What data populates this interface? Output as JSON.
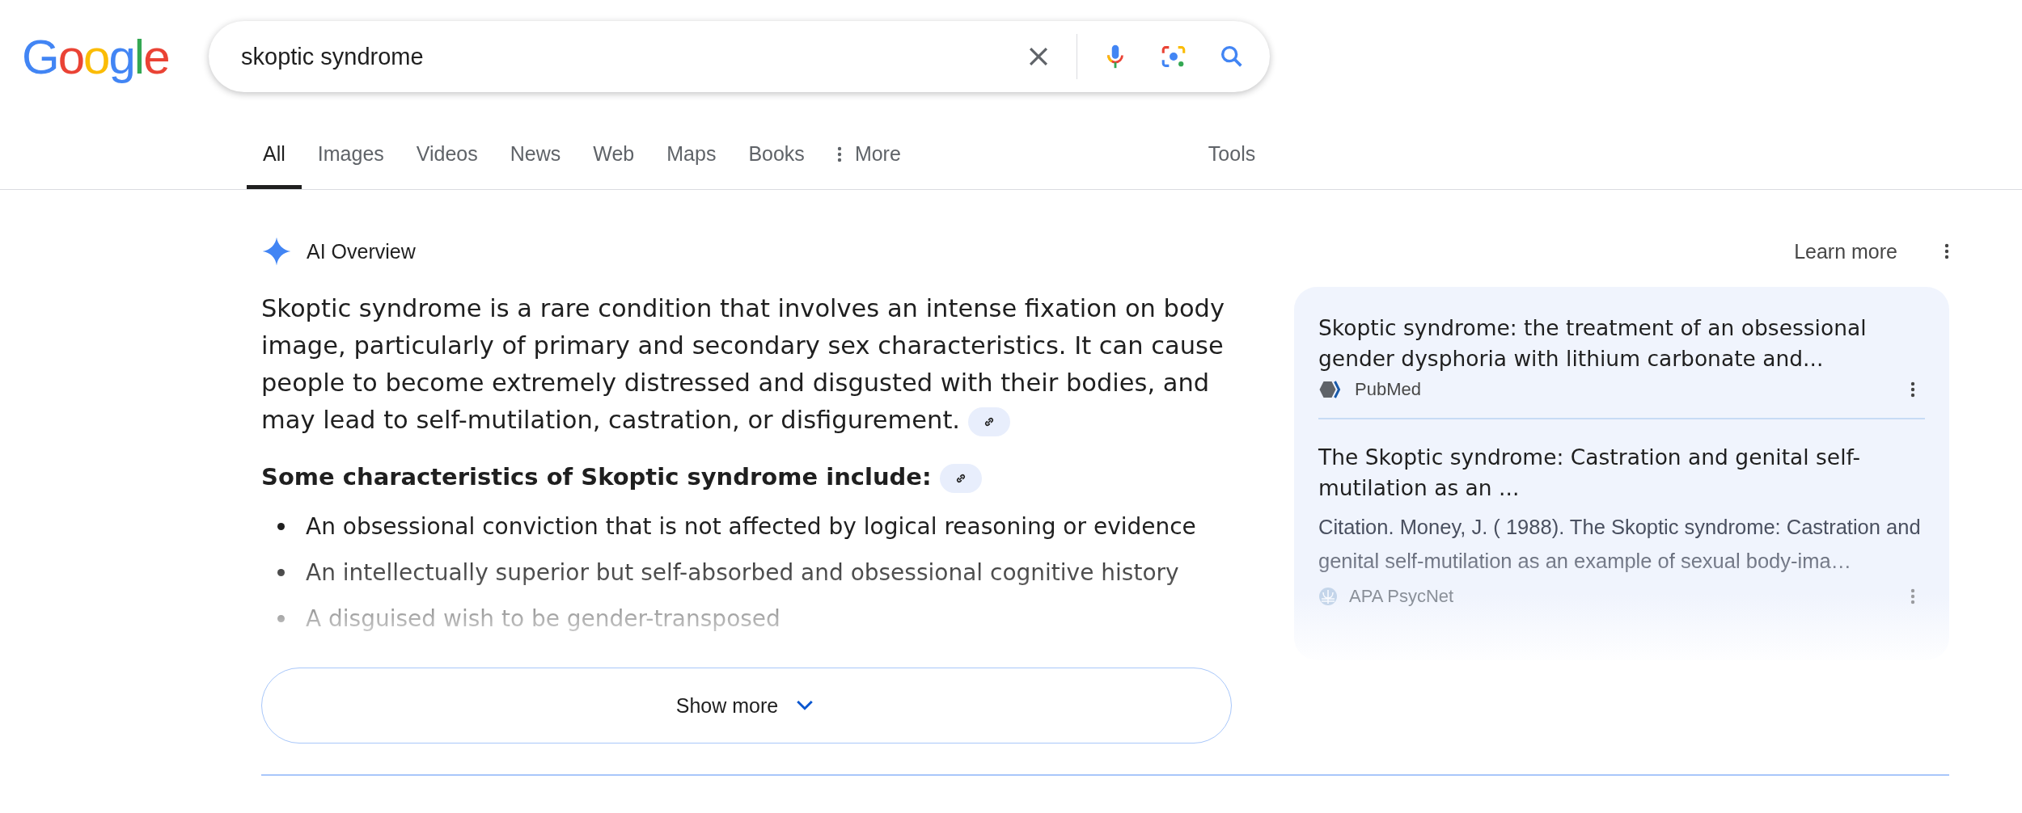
{
  "logo": "Google",
  "search": {
    "value": "skoptic syndrome"
  },
  "tabs": [
    {
      "label": "All",
      "selected": true,
      "kind": "plain"
    },
    {
      "label": "Images",
      "selected": false,
      "kind": "plain"
    },
    {
      "label": "Videos",
      "selected": false,
      "kind": "plain"
    },
    {
      "label": "News",
      "selected": false,
      "kind": "plain"
    },
    {
      "label": "Web",
      "selected": false,
      "kind": "plain"
    },
    {
      "label": "Maps",
      "selected": false,
      "kind": "plain"
    },
    {
      "label": "Books",
      "selected": false,
      "kind": "plain"
    },
    {
      "label": "More",
      "selected": false,
      "kind": "menu"
    }
  ],
  "tools": "Tools",
  "ai_overview": {
    "title": "AI Overview",
    "learn_more": "Learn more",
    "summary": "Skoptic syndrome is a rare condition that involves an intense fixation on body image, particularly of primary and secondary sex characteristics. It can cause people to become extremely distressed and disgusted with their bodies, and may lead to self-mutilation, castration, or disfigurement.",
    "heading": "Some characteristics of Skoptic syndrome include:",
    "bullets": [
      "An obsessional conviction that is not affected by logical reasoning or evidence",
      "An intellectually superior but self-absorbed and obsessional cognitive history",
      "A disguised wish to be gender-transposed"
    ],
    "show_more": "Show more",
    "sources": [
      {
        "title": "Skoptic syndrome: the treatment of an obsessional gender dysphoria with lithium carbonate and...",
        "site": "PubMed",
        "kind": "pubmed"
      },
      {
        "title": "The Skoptic syndrome: Castration and genital self-mutilation as an ...",
        "snippet": "Citation. Money, J. ( 1988). The Skoptic syndrome: Castration and genital self-mutilation as an example of sexual body-ima…",
        "site": "APA PsycNet",
        "kind": "psycnet"
      }
    ]
  }
}
